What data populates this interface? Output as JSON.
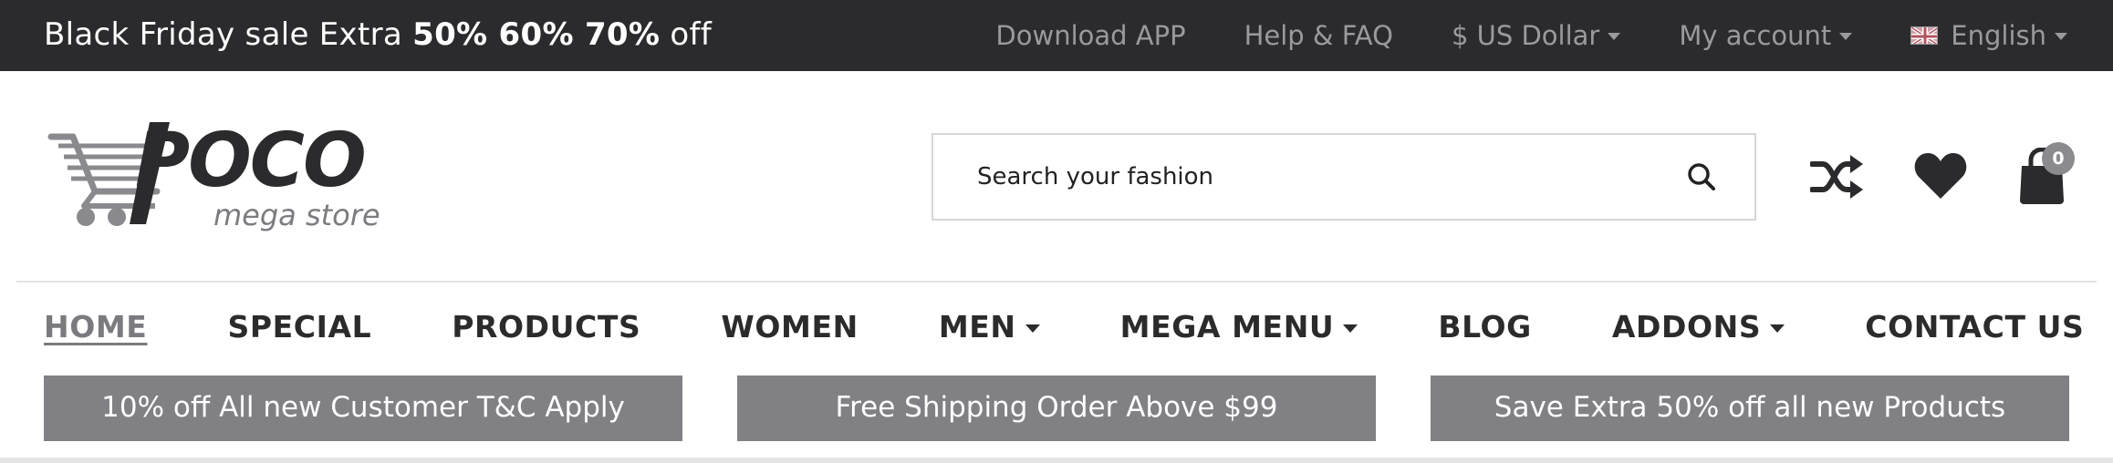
{
  "topbar": {
    "promo_prefix": "Black Friday sale Extra ",
    "promo_highlight": "50% 60% 70%",
    "promo_suffix": " off",
    "links": {
      "download": "Download APP",
      "help": "Help & FAQ",
      "currency": "$ US Dollar",
      "account": "My account",
      "language": "English"
    }
  },
  "logo": {
    "brand": "POCO",
    "tagline": "mega store"
  },
  "search": {
    "placeholder": "Search your fashion"
  },
  "cart": {
    "count": "0"
  },
  "nav": {
    "home": "HOME",
    "special": "SPECIAL",
    "products": "PRODUCTS",
    "women": "WOMEN",
    "men": "MEN",
    "mega_menu": "MEGA MENU",
    "blog": "BLOG",
    "addons": "ADDONS",
    "contact": "CONTACT US"
  },
  "banners": {
    "first": "10% off All new Customer T&C Apply",
    "second": "Free Shipping Order Above $99",
    "third": "Save Extra 50% off all new Products"
  },
  "colors": {
    "topbar_bg": "#2b2b2d",
    "banner_bg": "#808085",
    "badge_bg": "#8a8a8f",
    "nav_active": "#7b7b7f"
  },
  "icons": {
    "search": "search-icon",
    "compare": "shuffle-icon",
    "wishlist": "heart-icon",
    "cart": "shopping-bag-icon",
    "language_flag": "uk-flag-icon",
    "logo_cart": "shopping-cart-icon"
  }
}
